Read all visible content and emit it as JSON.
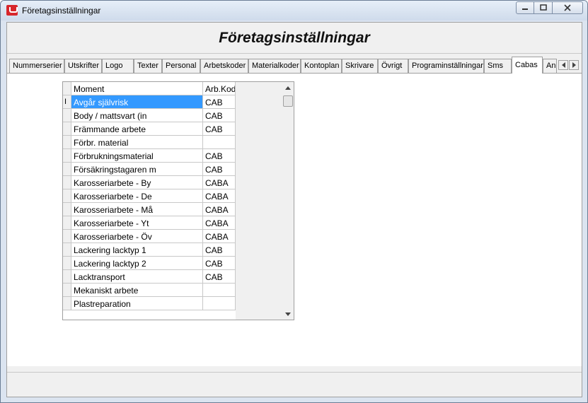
{
  "window": {
    "title": "Företagsinställningar"
  },
  "header": {
    "title": "Företagsinställningar"
  },
  "tabs": [
    {
      "label": "Nummerserier"
    },
    {
      "label": "Utskrifter"
    },
    {
      "label": "Logo"
    },
    {
      "label": "Texter"
    },
    {
      "label": "Personal"
    },
    {
      "label": "Arbetskoder"
    },
    {
      "label": "Materialkoder"
    },
    {
      "label": "Kontoplan"
    },
    {
      "label": "Skrivare"
    },
    {
      "label": "Övrigt"
    },
    {
      "label": "Programinställningar"
    },
    {
      "label": "Sms"
    },
    {
      "label": "Cabas"
    },
    {
      "label": "An"
    }
  ],
  "active_tab": "Cabas",
  "grid": {
    "columns": [
      "Moment",
      "Arb.Kod"
    ],
    "rows": [
      [
        "Avgår självrisk",
        "CAB"
      ],
      [
        "Body / mattsvart (in",
        "CAB"
      ],
      [
        "Främmande arbete",
        "CAB"
      ],
      [
        "Förbr. material",
        ""
      ],
      [
        "Förbrukningsmaterial",
        "CAB"
      ],
      [
        "Försäkringstagaren m",
        "CAB"
      ],
      [
        "Karosseriarbete - By",
        "CABA"
      ],
      [
        "Karosseriarbete - De",
        "CABA"
      ],
      [
        "Karosseriarbete - Må",
        "CABA"
      ],
      [
        "Karosseriarbete - Yt",
        "CABA"
      ],
      [
        "Karosseriarbete - Öv",
        "CABA"
      ],
      [
        "Lackering lacktyp 1",
        "CAB"
      ],
      [
        "Lackering lacktyp 2",
        "CAB"
      ],
      [
        "Lacktransport",
        "CAB"
      ],
      [
        "Mekaniskt arbete",
        ""
      ],
      [
        "Plastreparation",
        ""
      ]
    ],
    "cursor_glyph": "I"
  },
  "icons": {
    "minimize": "minimize-icon",
    "maximize": "maximize-icon",
    "close": "close-icon",
    "scroll_up": "arrow-up-icon",
    "scroll_down": "arrow-down-icon",
    "tab_left": "chevron-left-icon",
    "tab_right": "chevron-right-icon"
  },
  "colors": {
    "selection": "#3399ff",
    "app_icon": "#d7262b"
  }
}
